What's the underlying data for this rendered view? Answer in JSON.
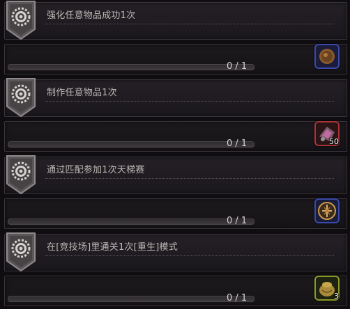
{
  "quests": [
    {
      "title": "强化任意物品成功1次",
      "progress_text": "0 / 1",
      "progress_fraction": 0,
      "reward": {
        "icon": "gold-pouch-icon",
        "quantity": "",
        "frame_color": "#3b4aa8"
      }
    },
    {
      "title": "制作任意物品1次",
      "progress_text": "0 / 1",
      "progress_fraction": 0,
      "reward": {
        "icon": "crafting-materials-icon",
        "quantity": "50",
        "frame_color": "#a8343a"
      }
    },
    {
      "title": "通过匹配参加1次天梯赛",
      "progress_text": "0 / 1",
      "progress_fraction": 0,
      "reward": {
        "icon": "ladder-emblem-icon",
        "quantity": "",
        "frame_color": "#3b4aa8"
      }
    },
    {
      "title": "在[竞技场]里通关1次[重生]模式",
      "progress_text": "0 / 1",
      "progress_fraction": 0,
      "reward": {
        "icon": "treasure-bag-icon",
        "quantity": "3",
        "frame_color": "#8a9a2a"
      }
    }
  ]
}
